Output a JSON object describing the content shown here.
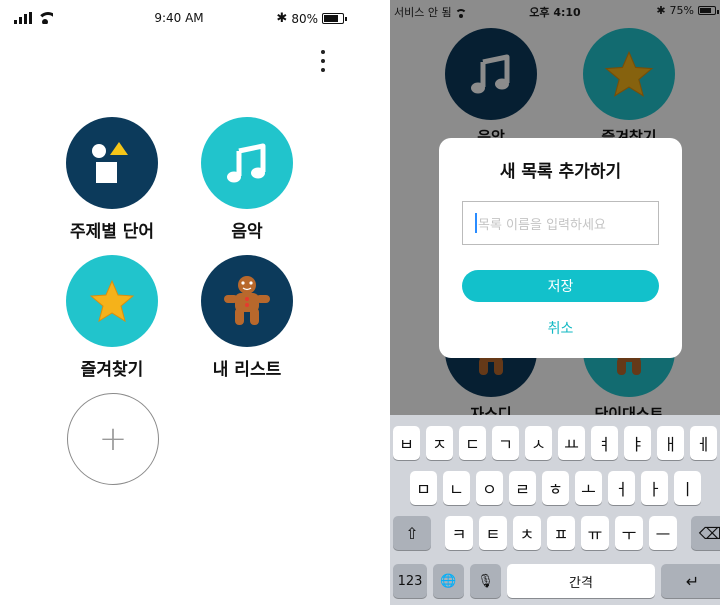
{
  "left_screen": {
    "status": {
      "time": "9:40 AM",
      "battery": "80%"
    },
    "tiles": [
      {
        "label": "주제별 단어"
      },
      {
        "label": "음악"
      },
      {
        "label": "즐겨찾기"
      },
      {
        "label": "내 리스트"
      }
    ],
    "add_symbol": "+"
  },
  "right_screen": {
    "status": {
      "carrier": "서비스 안 됨",
      "time": "오후 4:10",
      "battery": "75%"
    },
    "background_tiles": [
      {
        "label": "음악"
      },
      {
        "label": "즐겨찾기"
      },
      {
        "label": "자스디"
      },
      {
        "label": "단이대스트"
      }
    ],
    "dialog": {
      "title": "새 목록 추가하기",
      "input_placeholder": "목록 이름을 입력하세요",
      "save_label": "저장",
      "cancel_label": "취소"
    },
    "keyboard": {
      "row1": [
        "ㅂ",
        "ㅈ",
        "ㄷ",
        "ㄱ",
        "ㅅ",
        "ㅛ",
        "ㅕ",
        "ㅑ",
        "ㅐ",
        "ㅔ"
      ],
      "row2": [
        "ㅁ",
        "ㄴ",
        "ㅇ",
        "ㄹ",
        "ㅎ",
        "ㅗ",
        "ㅓ",
        "ㅏ",
        "ㅣ"
      ],
      "row3": [
        "ㅋ",
        "ㅌ",
        "ㅊ",
        "ㅍ",
        "ㅠ",
        "ㅜ",
        "ㅡ"
      ],
      "numbers_key": "123",
      "space_key": "간격",
      "shift_glyph": "⇧",
      "delete_glyph": "⌫",
      "globe_glyph": "🌐",
      "mic_glyph": "🎙",
      "return_glyph": "↵"
    }
  },
  "colors": {
    "navy": "#0c3a5b",
    "teal": "#21c4cc",
    "save_button": "#12c1cb"
  }
}
